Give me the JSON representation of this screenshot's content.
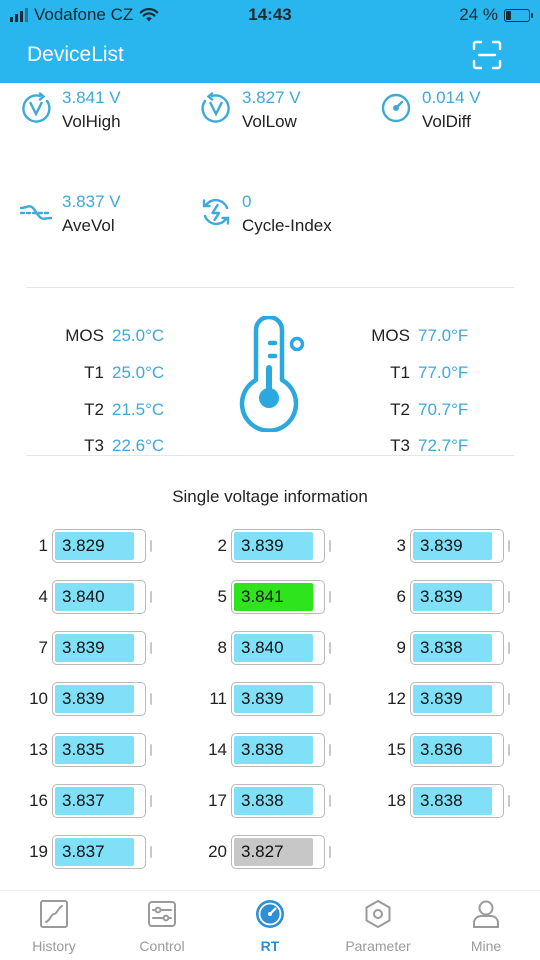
{
  "status_bar": {
    "carrier": "Vodafone CZ",
    "time": "14:43",
    "battery_text": "24 %",
    "battery_level": 0.24
  },
  "header": {
    "title": "DeviceList",
    "scan_icon": "scan-icon"
  },
  "metrics": [
    {
      "value": "3.841 V",
      "label": "VolHigh",
      "icon": "voltage-high-icon"
    },
    {
      "value": "3.827 V",
      "label": "VolLow",
      "icon": "voltage-low-icon"
    },
    {
      "value": "0.014 V",
      "label": "VolDiff",
      "icon": "gauge-icon"
    },
    {
      "value": "3.837 V",
      "label": "AveVol",
      "icon": "average-voltage-icon"
    },
    {
      "value": "0",
      "label": "Cycle-Index",
      "icon": "cycle-icon"
    }
  ],
  "temperatures": {
    "celsius": [
      {
        "label": "MOS",
        "value": "25.0°C"
      },
      {
        "label": "T1",
        "value": "25.0°C"
      },
      {
        "label": "T2",
        "value": "21.5°C"
      },
      {
        "label": "T3",
        "value": "22.6°C"
      }
    ],
    "fahrenheit": [
      {
        "label": "MOS",
        "value": "77.0°F"
      },
      {
        "label": "T1",
        "value": "77.0°F"
      },
      {
        "label": "T2",
        "value": "70.7°F"
      },
      {
        "label": "T3",
        "value": "72.7°F"
      }
    ],
    "icon": "thermometer-icon"
  },
  "cells_section": {
    "title": "Single voltage information",
    "cells": [
      {
        "index": "1",
        "voltage": "3.829",
        "state": "normal"
      },
      {
        "index": "2",
        "voltage": "3.839",
        "state": "normal"
      },
      {
        "index": "3",
        "voltage": "3.839",
        "state": "normal"
      },
      {
        "index": "4",
        "voltage": "3.840",
        "state": "normal"
      },
      {
        "index": "5",
        "voltage": "3.841",
        "state": "high"
      },
      {
        "index": "6",
        "voltage": "3.839",
        "state": "normal"
      },
      {
        "index": "7",
        "voltage": "3.839",
        "state": "normal"
      },
      {
        "index": "8",
        "voltage": "3.840",
        "state": "normal"
      },
      {
        "index": "9",
        "voltage": "3.838",
        "state": "normal"
      },
      {
        "index": "10",
        "voltage": "3.839",
        "state": "normal"
      },
      {
        "index": "11",
        "voltage": "3.839",
        "state": "normal"
      },
      {
        "index": "12",
        "voltage": "3.839",
        "state": "normal"
      },
      {
        "index": "13",
        "voltage": "3.835",
        "state": "normal"
      },
      {
        "index": "14",
        "voltage": "3.838",
        "state": "normal"
      },
      {
        "index": "15",
        "voltage": "3.836",
        "state": "normal"
      },
      {
        "index": "16",
        "voltage": "3.837",
        "state": "normal"
      },
      {
        "index": "17",
        "voltage": "3.838",
        "state": "normal"
      },
      {
        "index": "18",
        "voltage": "3.838",
        "state": "normal"
      },
      {
        "index": "19",
        "voltage": "3.837",
        "state": "normal"
      },
      {
        "index": "20",
        "voltage": "3.827",
        "state": "low"
      }
    ]
  },
  "bottom_nav": [
    {
      "label": "History",
      "icon": "history-chart-icon",
      "active": false
    },
    {
      "label": "Control",
      "icon": "control-sliders-icon",
      "active": false
    },
    {
      "label": "RT",
      "icon": "realtime-gauge-icon",
      "active": true
    },
    {
      "label": "Parameter",
      "icon": "parameter-hexagon-icon",
      "active": false
    },
    {
      "label": "Mine",
      "icon": "profile-icon",
      "active": false
    }
  ],
  "colors": {
    "accent": "#29b6ee",
    "value_text": "#3fa9d7",
    "cell_normal": "#7fe0f8",
    "cell_high": "#2ee41d",
    "cell_low": "#c7c7c7",
    "nav_active": "#2d8fd6"
  }
}
